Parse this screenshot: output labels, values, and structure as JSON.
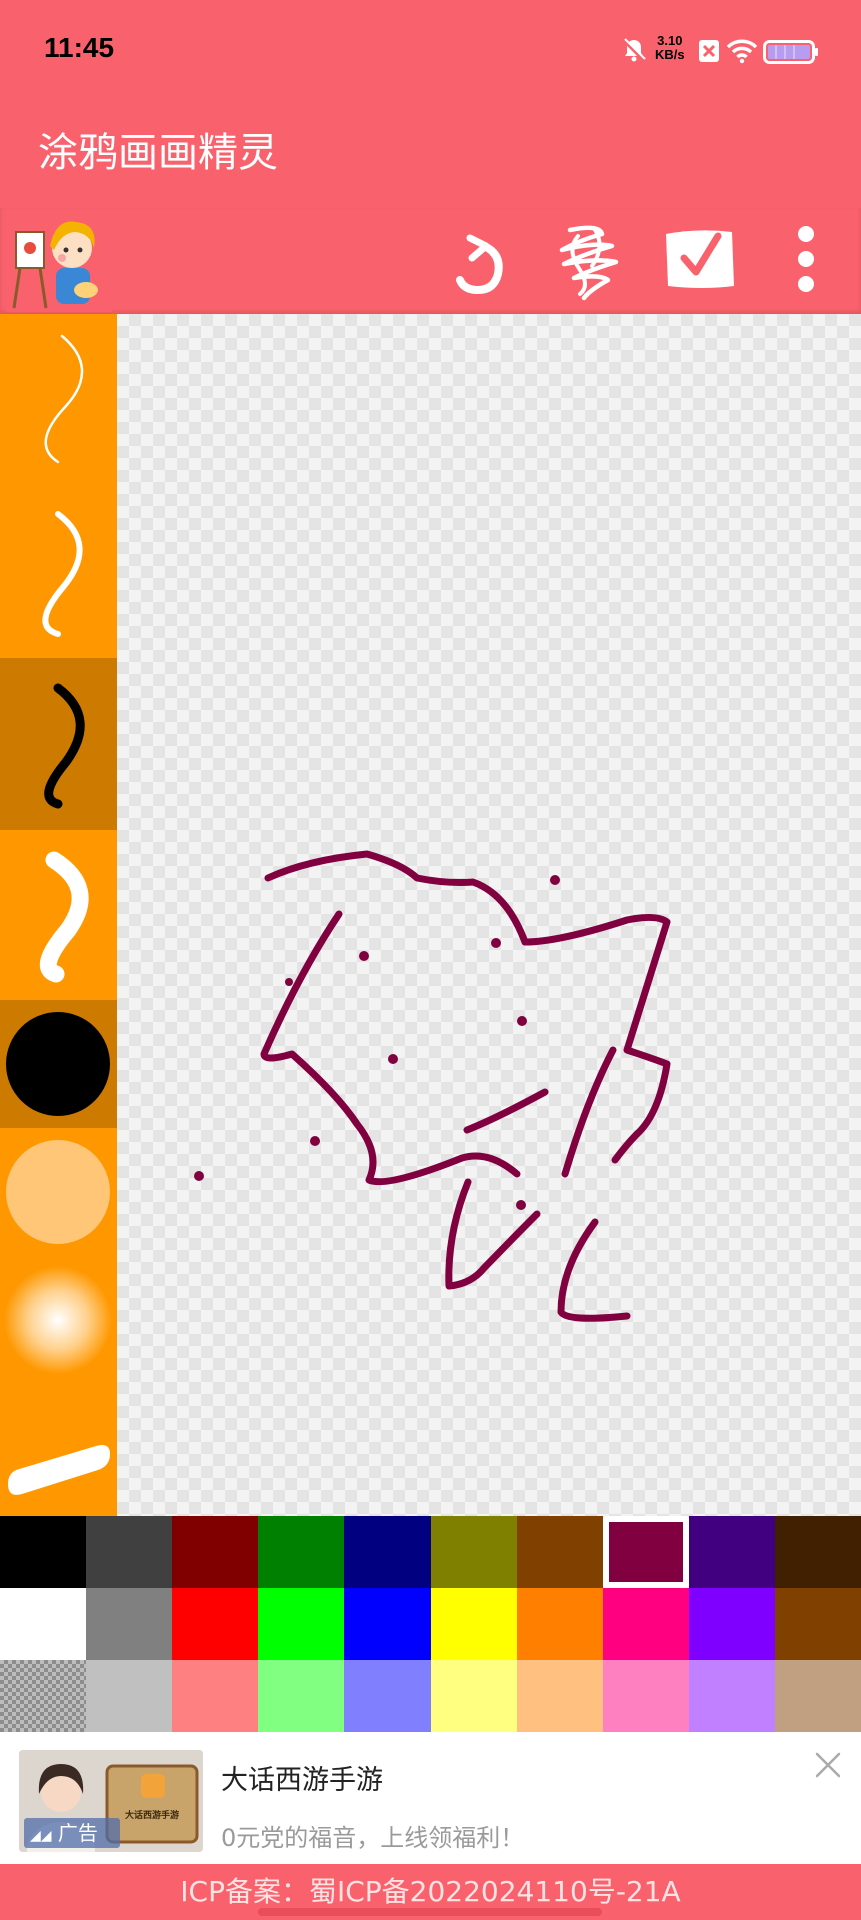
{
  "status_bar": {
    "time": "11:45",
    "net_speed_value": "3.10",
    "net_speed_unit": "KB/s",
    "icons": [
      "bell-off-icon",
      "close-box-icon",
      "wifi-icon",
      "battery-icon"
    ]
  },
  "app_bar": {
    "title": "涂鸦画画精灵"
  },
  "toolbar": {
    "icons": [
      "mascot-logo",
      "undo-icon",
      "scribble-clear-icon",
      "check-save-icon",
      "more-vert-icon"
    ]
  },
  "brush_tools": [
    {
      "name": "thin-line-brush",
      "selected": false
    },
    {
      "name": "medium-line-brush",
      "selected": false
    },
    {
      "name": "black-line-brush",
      "selected": true
    },
    {
      "name": "thick-line-brush",
      "selected": false
    },
    {
      "name": "black-circle-brush",
      "selected": true
    },
    {
      "name": "light-orange-circle-brush",
      "selected": false
    },
    {
      "name": "soft-glow-brush",
      "selected": false
    },
    {
      "name": "eraser-bar-brush",
      "selected": false
    }
  ],
  "palette": {
    "selected_color": "#800040",
    "rows": [
      [
        "#000000",
        "#404040",
        "#800000",
        "#008000",
        "#000080",
        "#808000",
        "#804000",
        "#800040",
        "#400080",
        "#402000"
      ],
      [
        "#ffffff",
        "#808080",
        "#ff0000",
        "#00ff00",
        "#0000ff",
        "#ffff00",
        "#ff8000",
        "#ff0080",
        "#8000ff",
        "#804000"
      ],
      [
        "transparent",
        "#c0c0c0",
        "#ff8080",
        "#80ff80",
        "#8080ff",
        "#ffff80",
        "#ffc080",
        "#ff80c0",
        "#c080ff",
        "#c0a080"
      ]
    ]
  },
  "drawing": {
    "stroke_color": "#800040"
  },
  "ad": {
    "title": "大话西游手游",
    "subtitle": "0元党的福音，上线领福利！",
    "badge": "广告",
    "thumb_caption": "大话西游手游"
  },
  "footer": {
    "icp": "ICP备案：蜀ICP备2022024110号-21A"
  }
}
